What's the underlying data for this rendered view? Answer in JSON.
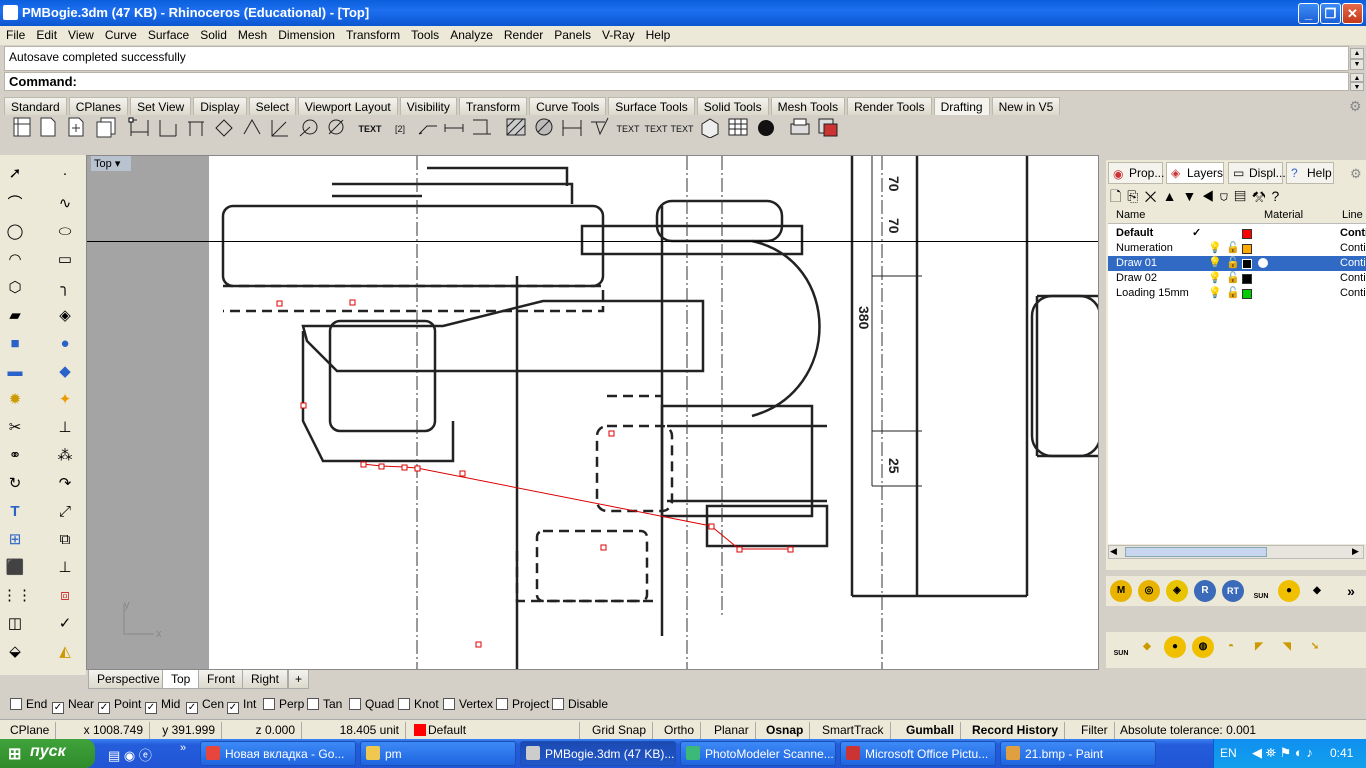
{
  "window": {
    "title": "PMBogie.3dm (47 KB) - Rhinoceros (Educational) - [Top]",
    "min": "_",
    "max": "❐",
    "close": "✕"
  },
  "menu": [
    "File",
    "Edit",
    "View",
    "Curve",
    "Surface",
    "Solid",
    "Mesh",
    "Dimension",
    "Transform",
    "Tools",
    "Analyze",
    "Render",
    "Panels",
    "V-Ray",
    "Help"
  ],
  "history_text": "Autosave completed successfully",
  "command_label": "Command:",
  "toolbar_tabs": [
    "Standard",
    "CPlanes",
    "Set View",
    "Display",
    "Select",
    "Viewport Layout",
    "Visibility",
    "Transform",
    "Curve Tools",
    "Surface Tools",
    "Solid Tools",
    "Mesh Tools",
    "Render Tools",
    "Drafting",
    "New in V5"
  ],
  "active_tab": "Drafting",
  "drafting_icons": [
    "dim-ortho-icon",
    "dim-linear-icon",
    "dim-aligned-icon",
    "dim-rotated-icon",
    "dim-angle-icon",
    "dim-angle2-icon",
    "dim-angle45-icon",
    "dim-radius-icon",
    "dim-diameter-icon",
    "text-icon",
    "leader-icon",
    "leader2-icon",
    "dim-ordinate-icon",
    "dim-ordinate2-icon",
    "hatch-icon",
    "hatch2-icon",
    "dim-update-icon",
    "dim-edit-icon",
    "text-edit-icon",
    "text-block-icon",
    "text-object-icon",
    "make2d-icon",
    "grid-icon",
    "sphere-dot-icon",
    "print-icon",
    "layout-icon"
  ],
  "toolbar_text": {
    "t1": "TEXT",
    "t2": "[2]",
    "t3": "TEXT",
    "t4": "TEXT",
    "t5": "TEXT"
  },
  "viewport": {
    "label": "Top",
    "axis_y": "y",
    "axis_x": "x"
  },
  "viewport_tabs": [
    "Perspective",
    "Top",
    "Front",
    "Right"
  ],
  "viewport_add": "+",
  "active_viewport": "Top",
  "drawing_dims": {
    "d1": "70",
    "d2": "70",
    "d3": "380",
    "d4": "25"
  },
  "osnaps": [
    {
      "label": "End",
      "checked": false
    },
    {
      "label": "Near",
      "checked": true
    },
    {
      "label": "Point",
      "checked": true
    },
    {
      "label": "Mid",
      "checked": true
    },
    {
      "label": "Cen",
      "checked": true
    },
    {
      "label": "Int",
      "checked": true
    },
    {
      "label": "Perp",
      "checked": false
    },
    {
      "label": "Tan",
      "checked": false
    },
    {
      "label": "Quad",
      "checked": false
    },
    {
      "label": "Knot",
      "checked": false
    },
    {
      "label": "Vertex",
      "checked": false
    },
    {
      "label": "Project",
      "checked": false
    },
    {
      "label": "Disable",
      "checked": false
    }
  ],
  "status": {
    "cplane": "CPlane",
    "x": "x 1008.749",
    "y": "y 391.999",
    "z": "z 0.000",
    "unit": "18.405 unit",
    "layer": "Default",
    "layer_color": "#ff0000",
    "grid_snap": "Grid Snap",
    "ortho": "Ortho",
    "planar": "Planar",
    "osnap": "Osnap",
    "smarttrack": "SmartTrack",
    "gumball": "Gumball",
    "record_history": "Record History",
    "filter": "Filter",
    "tolerance": "Absolute tolerance: 0.001"
  },
  "panel_tabs": [
    "Prop...",
    "Layers",
    "Displ...",
    "Help"
  ],
  "active_panel": "Layers",
  "layer_columns": {
    "name": "Name",
    "material": "Material",
    "linetype": "Line"
  },
  "layers": [
    {
      "name": "Default",
      "color": "#ff0000",
      "current": true,
      "linetype": "Conti",
      "current_mark": "✓"
    },
    {
      "name": "Numeration",
      "color": "#ffaa00",
      "linetype": "Conti"
    },
    {
      "name": "Draw 01",
      "color": "#000000",
      "linetype": "Conti",
      "selected": true
    },
    {
      "name": "Draw 02",
      "color": "#000000",
      "linetype": "Conti"
    },
    {
      "name": "Loading 15mm",
      "color": "#00cc00",
      "linetype": "Conti"
    }
  ],
  "render_tools": {
    "m": "M",
    "r": "R",
    "rt": "RT",
    "sun": "SUN",
    "more": "»"
  },
  "taskbar": {
    "start": "пуск",
    "tasks": [
      "Новая вкладка - Go...",
      "pm",
      "PMBogie.3dm (47 KB)...",
      "PhotoModeler Scanne...",
      "Microsoft Office Pictu...",
      "21.bmp - Paint"
    ],
    "active_task": "PMBogie.3dm (47 KB)...",
    "lang": "EN",
    "clock": "0:41",
    "expand": "»"
  }
}
